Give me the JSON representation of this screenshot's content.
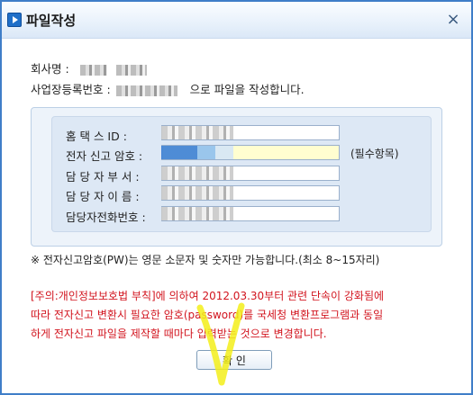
{
  "window": {
    "title": "파일작성",
    "close_label": "×"
  },
  "info": {
    "company_label": "회사명 :",
    "biz_no_label": "사업장등록번호 :",
    "biz_no_suffix": "으로 파일을 작성합니다."
  },
  "form": {
    "rows": [
      {
        "label": "홈 택 스 ID :",
        "value": "",
        "required": false
      },
      {
        "label": "전자 신고 암호 :",
        "value": "",
        "required": true
      },
      {
        "label": "담 당 자 부 서 :",
        "value": "",
        "required": false
      },
      {
        "label": "담 당 자 이 름 :",
        "value": "",
        "required": false
      },
      {
        "label": "담당자전화번호 :",
        "value": "",
        "required": false
      }
    ],
    "required_note": "(필수항목)"
  },
  "password_note": "※ 전자신고암호(PW)는 영문 소문자 및 숫자만 가능합니다.(최소 8~15자리)",
  "notice": {
    "line1": "[주의:개인정보보호법 부칙]에 의하여 2012.03.30부터 관련 단속이 강화됨에",
    "line2": "따라 전자신고 변환시 필요한 암호(password)를 국세청 변환프로그램과 동일",
    "line3": "하게 전자신고 파일을 제작할 때마다 입력받는 것으로 변경합니다."
  },
  "buttons": {
    "ok_label": "확 인"
  },
  "colors": {
    "window_border": "#3f7ec8",
    "notice_text": "#d2141e",
    "required_field": "#fffed0",
    "annotation": "#f3ef1a"
  }
}
